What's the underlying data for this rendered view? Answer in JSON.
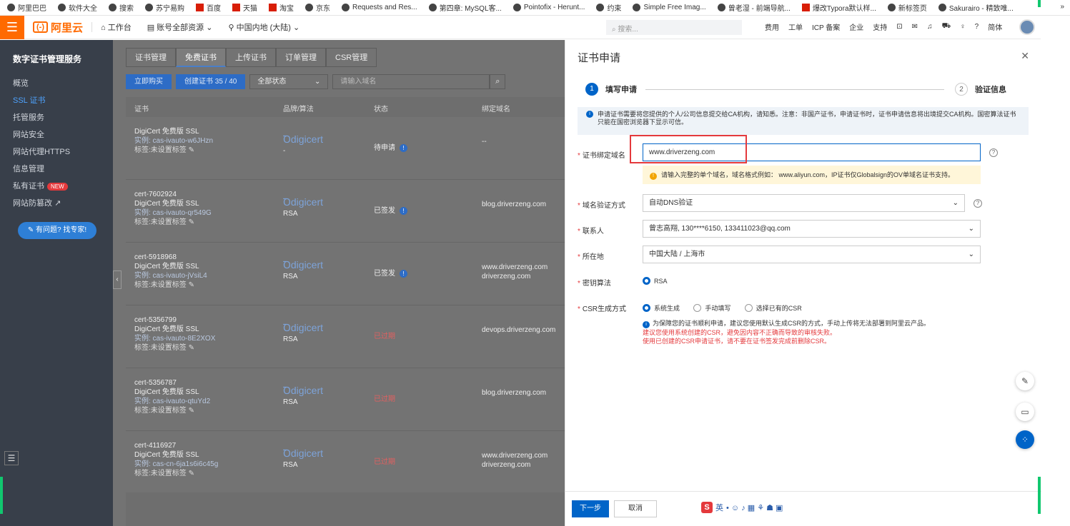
{
  "bookmarks": [
    "阿里巴巴",
    "软件大全",
    "搜索",
    "苏宁易购",
    "百度",
    "天猫",
    "淘宝",
    "京东",
    "Requests and Res...",
    "第四章: MySQL客...",
    "Pointofix - Herunt...",
    "约束",
    "Simple Free Imag...",
    "曾老湿 - 前端导航...",
    "爆改Typora默认样...",
    "新标签页",
    "Sakurairo - 精致唯..."
  ],
  "bookmarks_more": "»",
  "topbar": {
    "logo": "阿里云",
    "workbench": "工作台",
    "account": "账号全部资源",
    "region": "中国内地 (大陆)",
    "search_placeholder": "搜索...",
    "links": [
      "费用",
      "工单",
      "ICP 备案",
      "企业",
      "支持"
    ],
    "lang": "简体"
  },
  "sidebar": {
    "title": "数字证书管理服务",
    "items": [
      "概览",
      "SSL 证书",
      "托管服务",
      "网站安全",
      "网站代理HTTPS",
      "信息管理",
      "私有证书",
      "网站防篡改"
    ],
    "new_badge": "NEW",
    "ask": "有问题? 找专家!"
  },
  "main": {
    "tabs": [
      "证书管理",
      "免费证书",
      "上传证书",
      "订单管理",
      "CSR管理"
    ],
    "buy_btn": "立即购买",
    "create_btn": "创建证书 35 / 40",
    "status_select": "全部状态",
    "domain_placeholder": "请输入域名",
    "columns": [
      "证书",
      "品牌/算法",
      "状态",
      "绑定域名"
    ],
    "rows": [
      {
        "id": "",
        "name": "DigiCert 免费版 SSL",
        "inst": "实例: cas-ivauto-w6JHzn",
        "tag": "标签:未设置标签",
        "brand": "digicert",
        "alg": "-",
        "status": "待申请",
        "domains": [
          "--"
        ],
        "expired": false
      },
      {
        "id": "cert-7602924",
        "name": "DigiCert 免费版 SSL",
        "inst": "实例: cas-ivauto-qr549G",
        "tag": "标签:未设置标签",
        "brand": "digicert",
        "alg": "RSA",
        "status": "已签发",
        "domains": [
          "blog.driverzeng.com"
        ],
        "expired": false
      },
      {
        "id": "cert-5918968",
        "name": "DigiCert 免费版 SSL",
        "inst": "实例: cas-ivauto-jVsiL4",
        "tag": "标签:未设置标签",
        "brand": "digicert",
        "alg": "RSA",
        "status": "已签发",
        "domains": [
          "www.driverzeng.com",
          "driverzeng.com"
        ],
        "expired": false
      },
      {
        "id": "cert-5356799",
        "name": "DigiCert 免费版 SSL",
        "inst": "实例: cas-ivauto-8E2XOX",
        "tag": "标签:未设置标签",
        "brand": "digicert",
        "alg": "RSA",
        "status": "已过期",
        "domains": [
          "devops.driverzeng.com"
        ],
        "expired": true
      },
      {
        "id": "cert-5356787",
        "name": "DigiCert 免费版 SSL",
        "inst": "实例: cas-ivauto-qtuYd2",
        "tag": "标签:未设置标签",
        "brand": "digicert",
        "alg": "RSA",
        "status": "已过期",
        "domains": [
          "blog.driverzeng.com"
        ],
        "expired": true
      },
      {
        "id": "cert-4116927",
        "name": "DigiCert 免费版 SSL",
        "inst": "实例: cas-cn-6ja1s6i6c45g",
        "tag": "标签:未设置标签",
        "brand": "digicert",
        "alg": "RSA",
        "status": "已过期",
        "domains": [
          "www.driverzeng.com",
          "driverzeng.com"
        ],
        "expired": true
      }
    ]
  },
  "panel": {
    "title": "证书申请",
    "step1": "填写申请",
    "step1_num": "1",
    "step2": "验证信息",
    "step2_num": "2",
    "info": "申请证书需要将您提供的个人/公司信息提交给CA机构，请知悉。注意：非国产证书，申请证书时，证书申请信息将出境提交CA机构。国密算法证书只能在国密浏览器下显示可信。",
    "domain_label": "证书绑定域名",
    "domain_value": "www.driverzeng.com",
    "domain_warn": "请输入完整的单个域名，域名格式例如：  www.aliyun.com，IP证书仅Globalsign的OV单域名证书支持。",
    "verify_label": "域名验证方式",
    "verify_value": "自动DNS验证",
    "contact_label": "联系人",
    "contact_value": "曾志高翔, 130****6150, 133411023@qq.com",
    "location_label": "所在地",
    "location_value": "中国大陆 / 上海市",
    "algo_label": "密钥算法",
    "algo_value": "RSA",
    "csr_label": "CSR生成方式",
    "csr_options": [
      "系统生成",
      "手动填写",
      "选择已有的CSR"
    ],
    "csr_note": "为保障您的证书顺利申请，建议您使用默认生成CSR的方式，手动上传将无法部署到阿里云产品。",
    "csr_red1": "建议您使用系统创建的CSR，避免因内容不正确而导致的审核失败。",
    "csr_red2": "使用已创建的CSR申请证书，请不要在证书签发完成前删除CSR。",
    "next": "下一步",
    "cancel": "取消",
    "ime": "英"
  }
}
